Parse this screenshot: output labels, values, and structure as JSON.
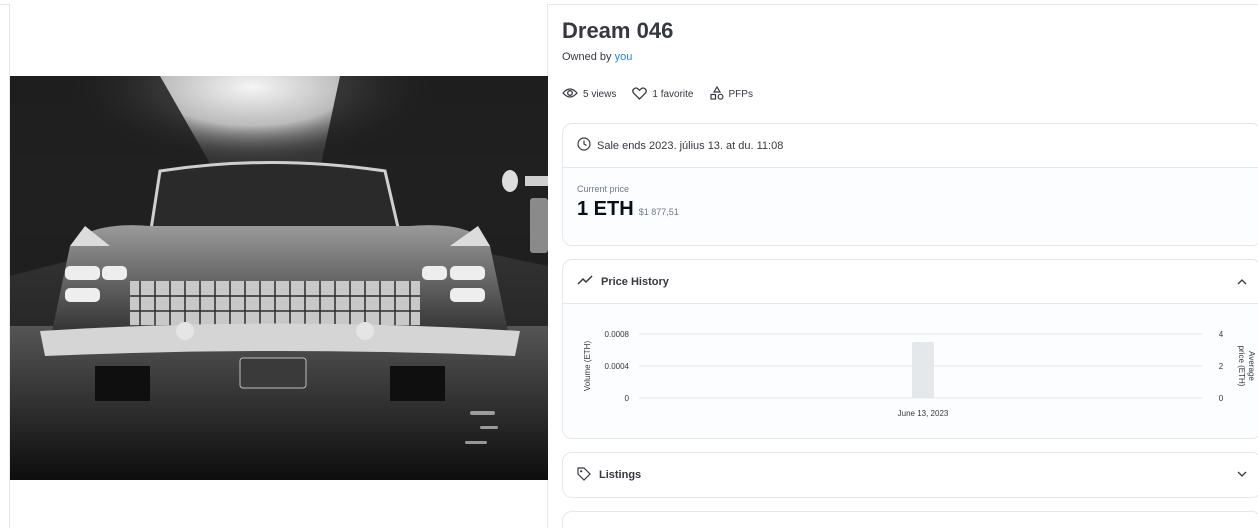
{
  "item": {
    "title": "Dream 046",
    "owned_prefix": "Owned by",
    "owner": "you"
  },
  "stats": {
    "views": "5 views",
    "favorites": "1 favorite",
    "collection": "PFPs"
  },
  "sale": {
    "ends_text": "Sale ends 2023. július 13. at du. 11:08",
    "current_price_label": "Current price",
    "price_eth": "1 ETH",
    "price_usd": "$1 877,51"
  },
  "price_history": {
    "title": "Price History"
  },
  "listings": {
    "title": "Listings"
  },
  "chart_data": {
    "type": "bar",
    "categories": [
      "June 13, 2023"
    ],
    "series": [
      {
        "values": [
          0.0007
        ]
      }
    ],
    "xlabel": "",
    "ylabel": "Volume (ETH)",
    "y2label": "Average price (ETH)",
    "ylim": [
      0,
      0.0008
    ],
    "y2lim": [
      0,
      4
    ],
    "y_ticks": [
      "0",
      "0.0004",
      "0.0008"
    ],
    "y2_ticks": [
      "0",
      "2",
      "4"
    ],
    "grid": true
  },
  "icons": {
    "views": "eye-icon",
    "favorites": "heart-icon",
    "collection": "shapes-icon",
    "sale": "clock-icon",
    "history": "trend-icon",
    "listings": "tag-icon"
  }
}
